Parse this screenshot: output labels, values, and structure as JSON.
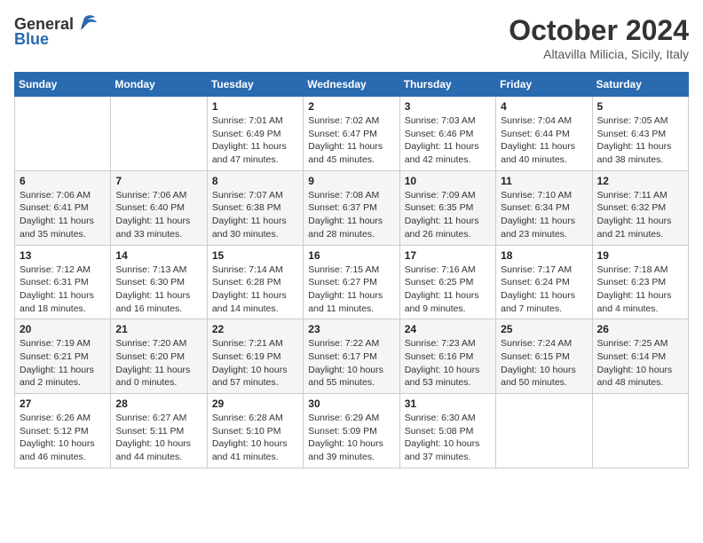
{
  "header": {
    "logo_line1": "General",
    "logo_line2": "Blue",
    "month_title": "October 2024",
    "subtitle": "Altavilla Milicia, Sicily, Italy"
  },
  "weekdays": [
    "Sunday",
    "Monday",
    "Tuesday",
    "Wednesday",
    "Thursday",
    "Friday",
    "Saturday"
  ],
  "weeks": [
    [
      {
        "day": "",
        "info": ""
      },
      {
        "day": "",
        "info": ""
      },
      {
        "day": "1",
        "info": "Sunrise: 7:01 AM\nSunset: 6:49 PM\nDaylight: 11 hours and 47 minutes."
      },
      {
        "day": "2",
        "info": "Sunrise: 7:02 AM\nSunset: 6:47 PM\nDaylight: 11 hours and 45 minutes."
      },
      {
        "day": "3",
        "info": "Sunrise: 7:03 AM\nSunset: 6:46 PM\nDaylight: 11 hours and 42 minutes."
      },
      {
        "day": "4",
        "info": "Sunrise: 7:04 AM\nSunset: 6:44 PM\nDaylight: 11 hours and 40 minutes."
      },
      {
        "day": "5",
        "info": "Sunrise: 7:05 AM\nSunset: 6:43 PM\nDaylight: 11 hours and 38 minutes."
      }
    ],
    [
      {
        "day": "6",
        "info": "Sunrise: 7:06 AM\nSunset: 6:41 PM\nDaylight: 11 hours and 35 minutes."
      },
      {
        "day": "7",
        "info": "Sunrise: 7:06 AM\nSunset: 6:40 PM\nDaylight: 11 hours and 33 minutes."
      },
      {
        "day": "8",
        "info": "Sunrise: 7:07 AM\nSunset: 6:38 PM\nDaylight: 11 hours and 30 minutes."
      },
      {
        "day": "9",
        "info": "Sunrise: 7:08 AM\nSunset: 6:37 PM\nDaylight: 11 hours and 28 minutes."
      },
      {
        "day": "10",
        "info": "Sunrise: 7:09 AM\nSunset: 6:35 PM\nDaylight: 11 hours and 26 minutes."
      },
      {
        "day": "11",
        "info": "Sunrise: 7:10 AM\nSunset: 6:34 PM\nDaylight: 11 hours and 23 minutes."
      },
      {
        "day": "12",
        "info": "Sunrise: 7:11 AM\nSunset: 6:32 PM\nDaylight: 11 hours and 21 minutes."
      }
    ],
    [
      {
        "day": "13",
        "info": "Sunrise: 7:12 AM\nSunset: 6:31 PM\nDaylight: 11 hours and 18 minutes."
      },
      {
        "day": "14",
        "info": "Sunrise: 7:13 AM\nSunset: 6:30 PM\nDaylight: 11 hours and 16 minutes."
      },
      {
        "day": "15",
        "info": "Sunrise: 7:14 AM\nSunset: 6:28 PM\nDaylight: 11 hours and 14 minutes."
      },
      {
        "day": "16",
        "info": "Sunrise: 7:15 AM\nSunset: 6:27 PM\nDaylight: 11 hours and 11 minutes."
      },
      {
        "day": "17",
        "info": "Sunrise: 7:16 AM\nSunset: 6:25 PM\nDaylight: 11 hours and 9 minutes."
      },
      {
        "day": "18",
        "info": "Sunrise: 7:17 AM\nSunset: 6:24 PM\nDaylight: 11 hours and 7 minutes."
      },
      {
        "day": "19",
        "info": "Sunrise: 7:18 AM\nSunset: 6:23 PM\nDaylight: 11 hours and 4 minutes."
      }
    ],
    [
      {
        "day": "20",
        "info": "Sunrise: 7:19 AM\nSunset: 6:21 PM\nDaylight: 11 hours and 2 minutes."
      },
      {
        "day": "21",
        "info": "Sunrise: 7:20 AM\nSunset: 6:20 PM\nDaylight: 11 hours and 0 minutes."
      },
      {
        "day": "22",
        "info": "Sunrise: 7:21 AM\nSunset: 6:19 PM\nDaylight: 10 hours and 57 minutes."
      },
      {
        "day": "23",
        "info": "Sunrise: 7:22 AM\nSunset: 6:17 PM\nDaylight: 10 hours and 55 minutes."
      },
      {
        "day": "24",
        "info": "Sunrise: 7:23 AM\nSunset: 6:16 PM\nDaylight: 10 hours and 53 minutes."
      },
      {
        "day": "25",
        "info": "Sunrise: 7:24 AM\nSunset: 6:15 PM\nDaylight: 10 hours and 50 minutes."
      },
      {
        "day": "26",
        "info": "Sunrise: 7:25 AM\nSunset: 6:14 PM\nDaylight: 10 hours and 48 minutes."
      }
    ],
    [
      {
        "day": "27",
        "info": "Sunrise: 6:26 AM\nSunset: 5:12 PM\nDaylight: 10 hours and 46 minutes."
      },
      {
        "day": "28",
        "info": "Sunrise: 6:27 AM\nSunset: 5:11 PM\nDaylight: 10 hours and 44 minutes."
      },
      {
        "day": "29",
        "info": "Sunrise: 6:28 AM\nSunset: 5:10 PM\nDaylight: 10 hours and 41 minutes."
      },
      {
        "day": "30",
        "info": "Sunrise: 6:29 AM\nSunset: 5:09 PM\nDaylight: 10 hours and 39 minutes."
      },
      {
        "day": "31",
        "info": "Sunrise: 6:30 AM\nSunset: 5:08 PM\nDaylight: 10 hours and 37 minutes."
      },
      {
        "day": "",
        "info": ""
      },
      {
        "day": "",
        "info": ""
      }
    ]
  ]
}
